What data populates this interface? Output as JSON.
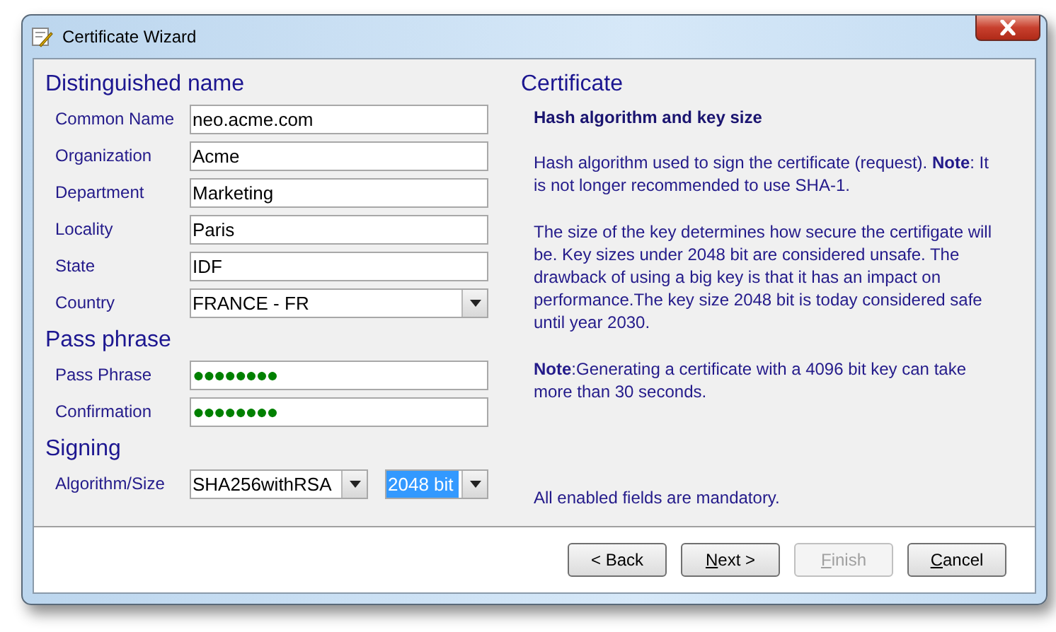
{
  "window": {
    "title": "Certificate Wizard"
  },
  "sections": [
    {
      "title": "Distinguished name",
      "fields": [
        {
          "label": "Common Name",
          "kind": "text",
          "value": "neo.acme.com"
        },
        {
          "label": "Organization",
          "kind": "text",
          "value": "Acme"
        },
        {
          "label": "Department",
          "kind": "text",
          "value": "Marketing"
        },
        {
          "label": "Locality",
          "kind": "text",
          "value": "Paris"
        },
        {
          "label": "State",
          "kind": "text",
          "value": "IDF"
        },
        {
          "label": "Country",
          "kind": "select",
          "value": "FRANCE - FR"
        }
      ]
    },
    {
      "title": "Pass phrase",
      "fields": [
        {
          "label": "Pass Phrase",
          "kind": "password",
          "value": "●●●●●●●●"
        },
        {
          "label": "Confirmation",
          "kind": "password",
          "value": "●●●●●●●●"
        }
      ]
    }
  ],
  "signing": {
    "title": "Signing",
    "label": "Algorithm/Size",
    "algorithm": "SHA256withRSA",
    "size": "2048 bit",
    "size_highlighted": true,
    "note": "All enabled fields are mandatory."
  },
  "help": {
    "title": "Certificate",
    "subtitle": "Hash algorithm and key size",
    "paragraphs": [
      "Hash algorithm used to sign the certificate (request). **Note**: It is not longer recommended to use SHA-1.",
      "The size of the key determines how secure the certifigate will be. Key sizes under 2048 bit are considered unsafe. The drawback of using a big key is that it has an impact on performance.The key size 2048 bit is today considered safe until year 2030.",
      "**Note**:Generating a certificate with a 4096 bit key can take more than 30 seconds."
    ]
  },
  "buttons": [
    {
      "rest": "< Back",
      "disabled": false
    },
    {
      "mnemonic": "N",
      "rest": "ext >",
      "disabled": false
    },
    {
      "mnemonic": "F",
      "rest": "inish",
      "disabled": true
    },
    {
      "mnemonic": "C",
      "rest": "ancel",
      "disabled": false
    }
  ]
}
